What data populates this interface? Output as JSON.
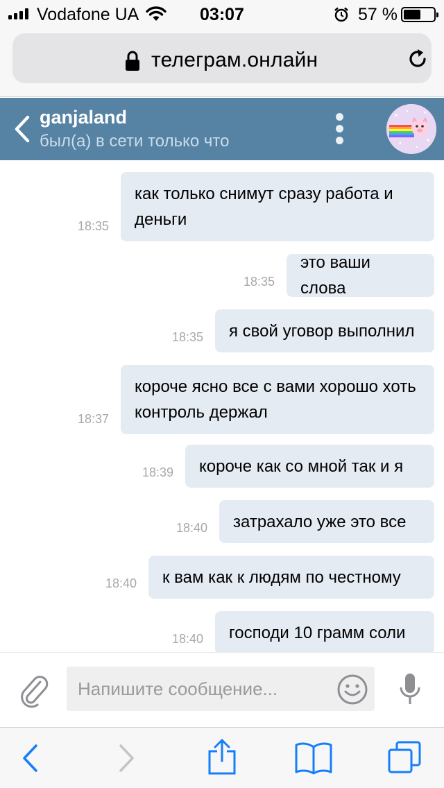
{
  "status_bar": {
    "carrier": "Vodafone UA",
    "time": "03:07",
    "battery_percent": "57 %",
    "battery_level": 0.57
  },
  "browser": {
    "url": "телеграм.онлайн"
  },
  "chat": {
    "name": "ganjaland",
    "status": "был(а) в сети только что",
    "messages": [
      {
        "text": "как только снимут сразу работа и деньги",
        "time": "18:35"
      },
      {
        "text": "это ваши слова",
        "time": "18:35"
      },
      {
        "text": "я свой уговор выполнил",
        "time": "18:35"
      },
      {
        "text": "короче ясно все с вами хорошо хоть контроль держал",
        "time": "18:37"
      },
      {
        "text": "короче как со мной так и я",
        "time": "18:39"
      },
      {
        "text": "затрахало уже это все",
        "time": "18:40"
      },
      {
        "text": "к вам как к людям по честному",
        "time": "18:40"
      },
      {
        "text": "господи 10 грамм соли",
        "time": "18:40"
      }
    ]
  },
  "composer": {
    "placeholder": "Напишите сообщение..."
  },
  "colors": {
    "header_bg": "#5682a3",
    "bubble_bg": "#e5ebf3",
    "toolbar_accent": "#157efb"
  }
}
